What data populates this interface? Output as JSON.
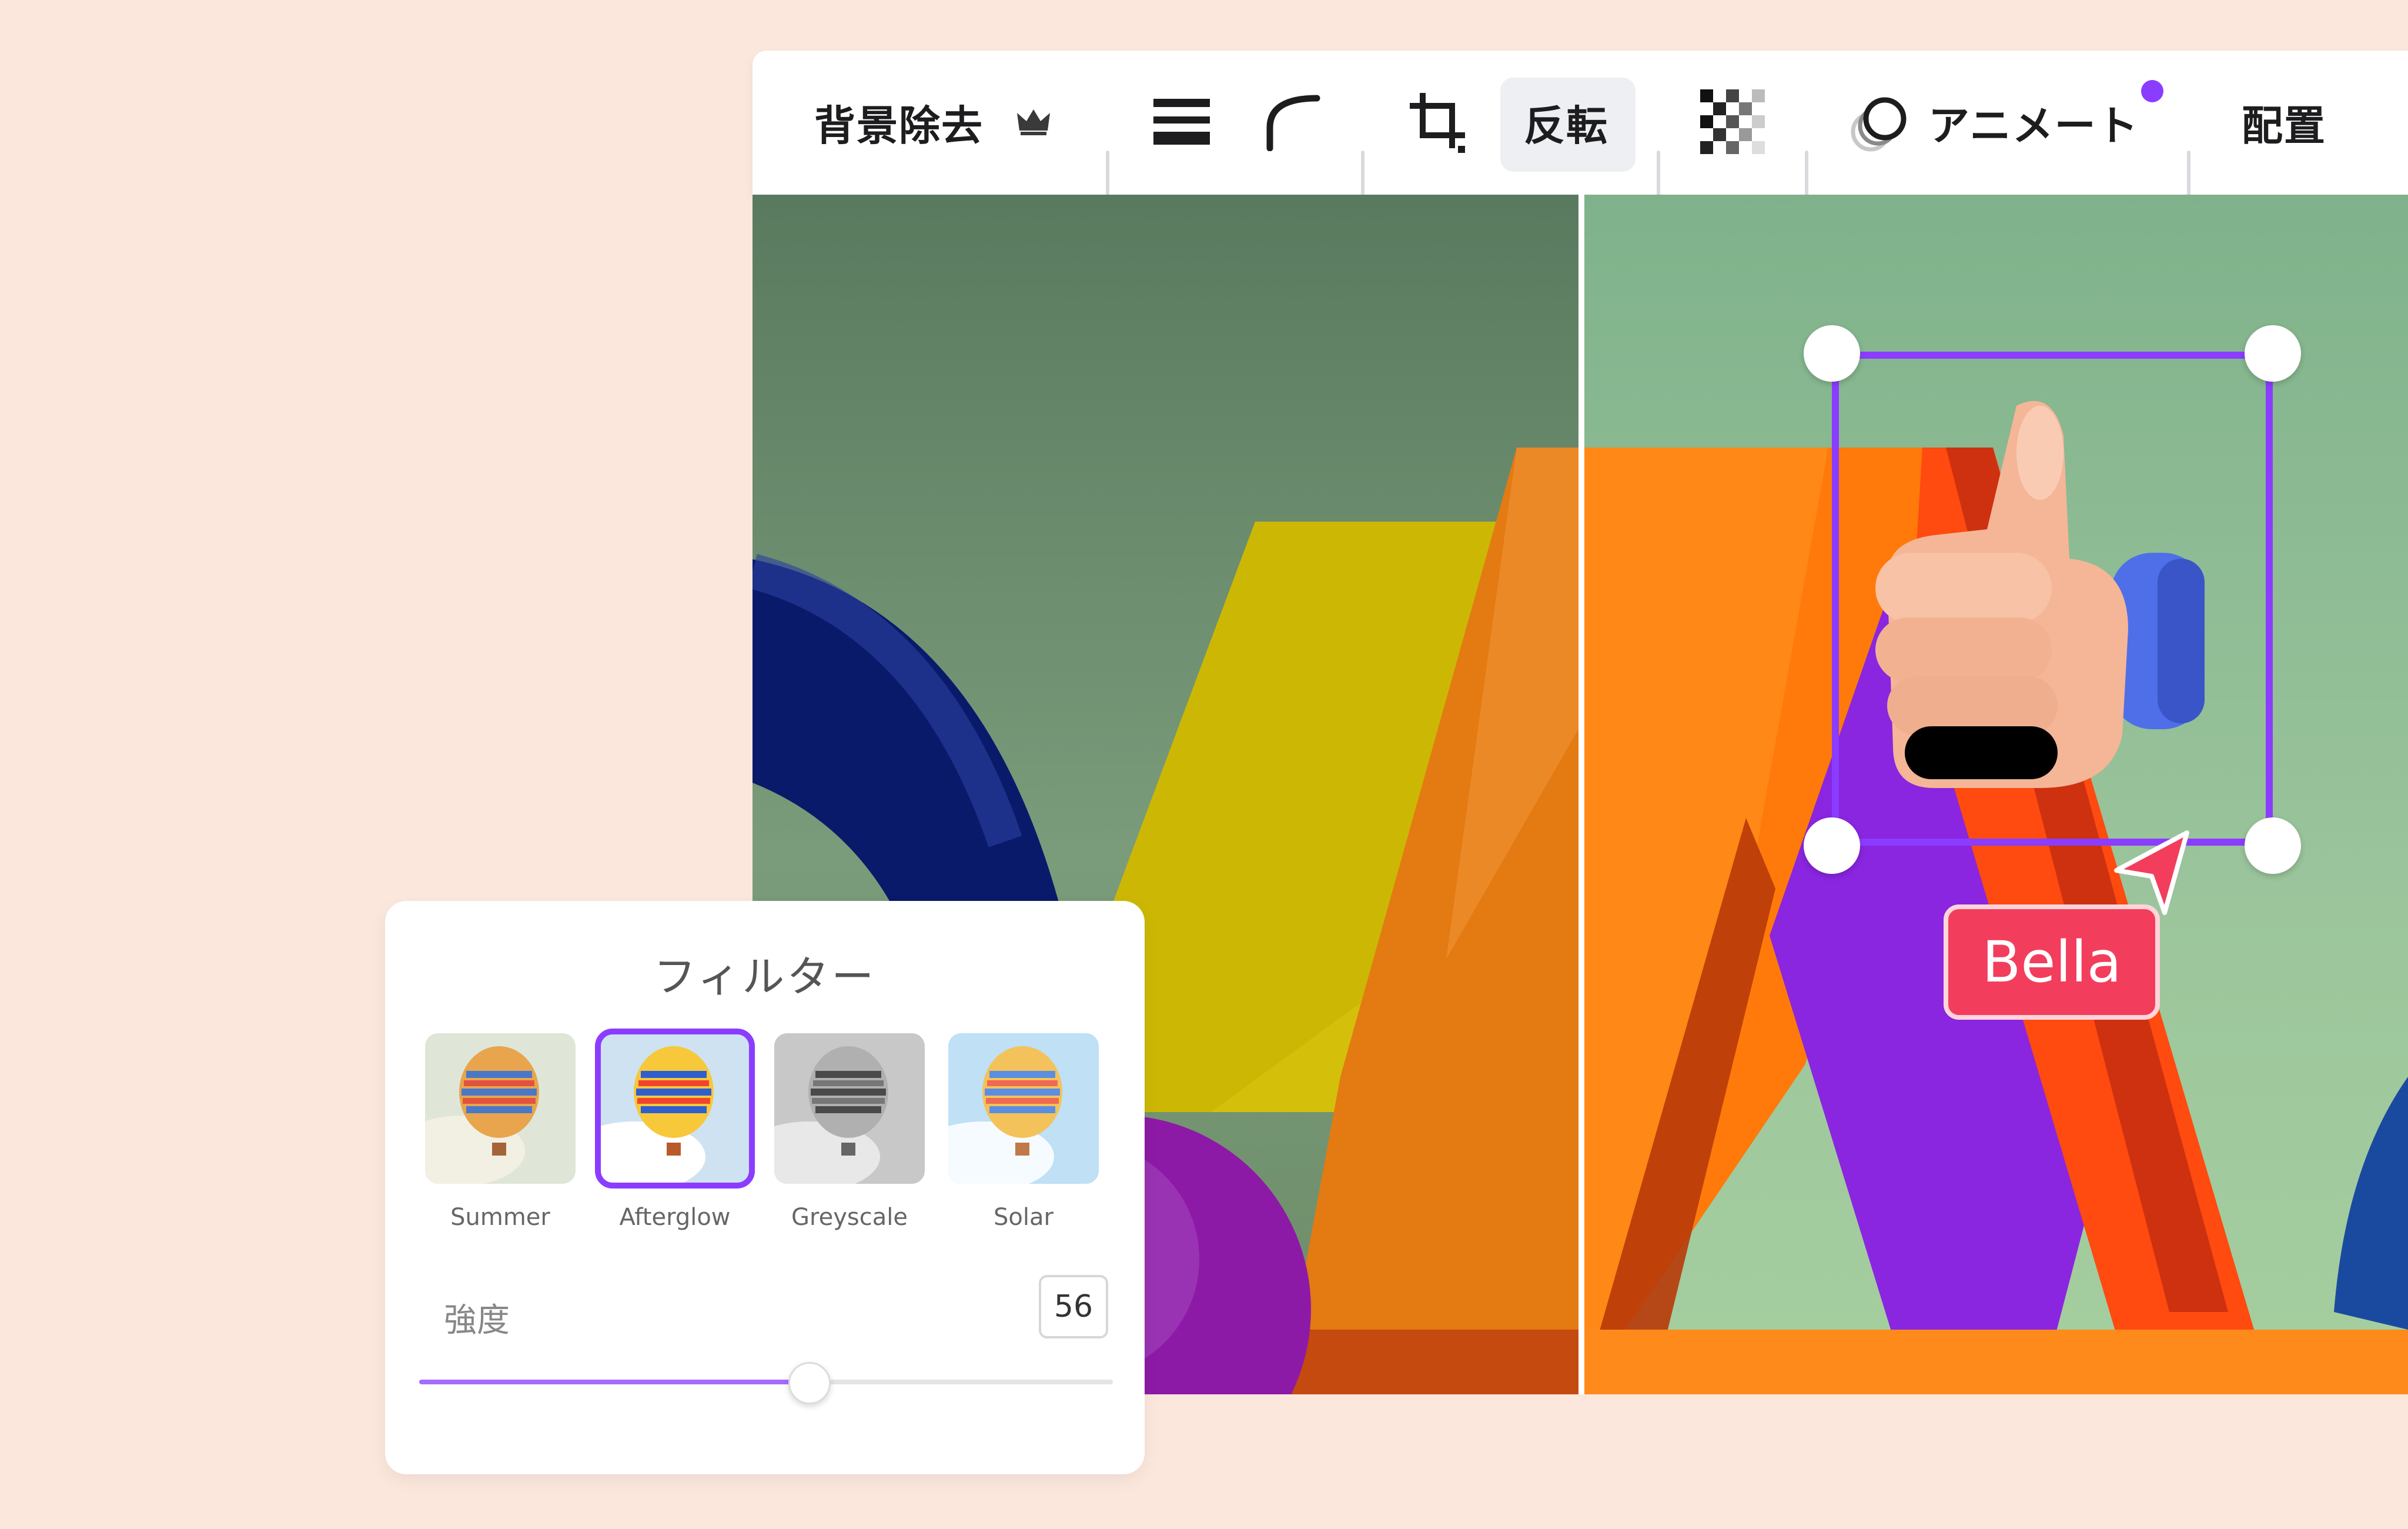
{
  "toolbar": {
    "remove_bg_label": "背景除去",
    "flip_label": "反転",
    "animate_label": "アニメート",
    "arrange_label": "配置"
  },
  "filter_panel": {
    "title": "フィルター",
    "filters": [
      {
        "label": "Summer",
        "selected": false
      },
      {
        "label": "Afterglow",
        "selected": true
      },
      {
        "label": "Greyscale",
        "selected": false
      },
      {
        "label": "Solar",
        "selected": false
      }
    ],
    "strength_label": "強度",
    "strength_value": "56"
  },
  "collaborator": {
    "name": "Bella"
  },
  "colors": {
    "accent": "#8b3dff",
    "user_tag": "#f23e5c",
    "background": "#fbe7dc"
  }
}
